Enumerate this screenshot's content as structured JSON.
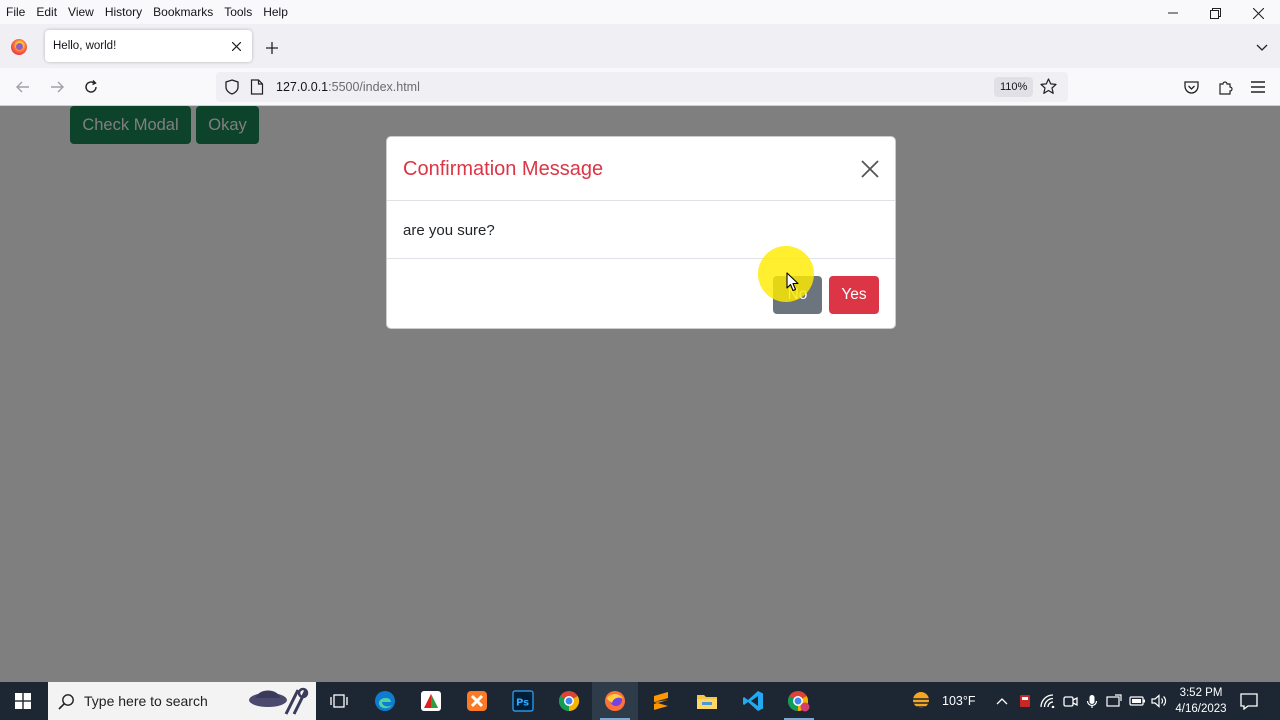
{
  "menubar": {
    "items": [
      "File",
      "Edit",
      "View",
      "History",
      "Bookmarks",
      "Tools",
      "Help"
    ]
  },
  "tab": {
    "title": "Hello, world!"
  },
  "navbar": {
    "url_host": "127.0.0.1",
    "url_rest": ":5500/index.html",
    "zoom": "110%"
  },
  "page": {
    "check_modal_label": "Check Modal",
    "okay_label": "Okay"
  },
  "modal": {
    "title": "Confirmation Message",
    "body": "are you sure?",
    "no_label": "No",
    "yes_label": "Yes"
  },
  "taskbar": {
    "search_placeholder": "Type here to search",
    "weather": "103°F",
    "time": "3:52 PM",
    "date": "4/16/2023"
  },
  "colors": {
    "primary_green": "#198754",
    "danger_red": "#dc3545",
    "secondary_gray": "#6c757d"
  }
}
